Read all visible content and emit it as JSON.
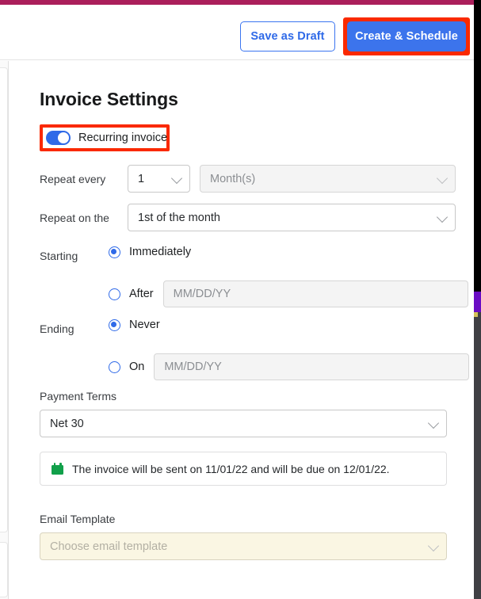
{
  "theme": {
    "accent_bar": "#ab1f5b",
    "primary_blue": "#3c74ec",
    "highlight_red": "#fa2900",
    "calendar_green": "#11a04a",
    "scrollbar_purple": "#6a0cc4"
  },
  "header": {
    "save_draft_label": "Save as Draft",
    "create_schedule_label": "Create & Schedule"
  },
  "main": {
    "title": "Invoice Settings",
    "recurring": {
      "label": "Recurring invoice",
      "enabled": "on"
    },
    "repeat_every": {
      "label": "Repeat every",
      "count_value": "1",
      "unit_value": "Month(s)"
    },
    "repeat_on": {
      "label": "Repeat on the",
      "value": "1st of the month"
    },
    "starting": {
      "label": "Starting",
      "option_immediately": "Immediately",
      "option_after": "After",
      "after_placeholder": "MM/DD/YY",
      "after_value": ""
    },
    "ending": {
      "label": "Ending",
      "option_never": "Never",
      "option_on": "On",
      "on_placeholder": "MM/DD/YY",
      "on_value": ""
    },
    "payment_terms": {
      "label": "Payment Terms",
      "value": "Net 30"
    },
    "notice": {
      "icon": "calendar-icon",
      "text": "The invoice will be sent on 11/01/22 and will be due on 12/01/22."
    },
    "email_template": {
      "label": "Email Template",
      "placeholder": "Choose email template",
      "value": "Choose email template"
    }
  }
}
